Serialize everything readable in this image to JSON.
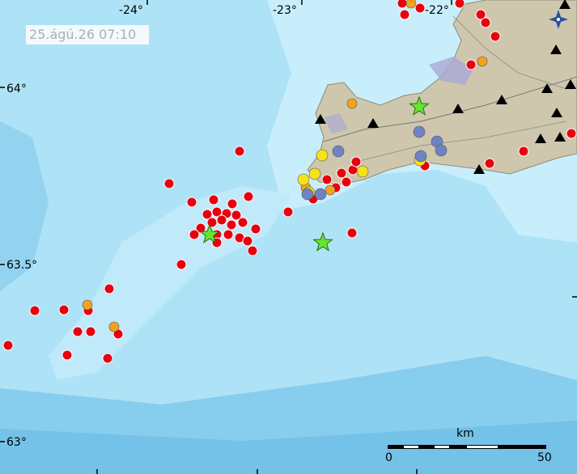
{
  "timestamp": "25.ágú.26  07:10",
  "axes": {
    "longitude_labels": [
      "-24°",
      "-23°",
      "-22°"
    ],
    "latitude_labels": [
      "64°",
      "63.5°",
      "63°"
    ]
  },
  "scale": {
    "unit": "km",
    "min": "0",
    "max": "50"
  },
  "colors": {
    "sea_shallow": "#c8eefb",
    "sea_mid": "#aee2f6",
    "sea_deep": "#87cdee",
    "land": "#cfc7ad",
    "glacier": "#a9a9d6",
    "quake_recent": "#e8000f",
    "quake_day": "#f2a21c",
    "quake_older": "#f7e21a",
    "quake_oldest": "#6f83c4",
    "large_quake_star": "#66e633",
    "station": "#000000"
  },
  "icons": {
    "compass": "compass-icon",
    "station": "seismic-station-icon",
    "large_quake": "star-icon"
  }
}
